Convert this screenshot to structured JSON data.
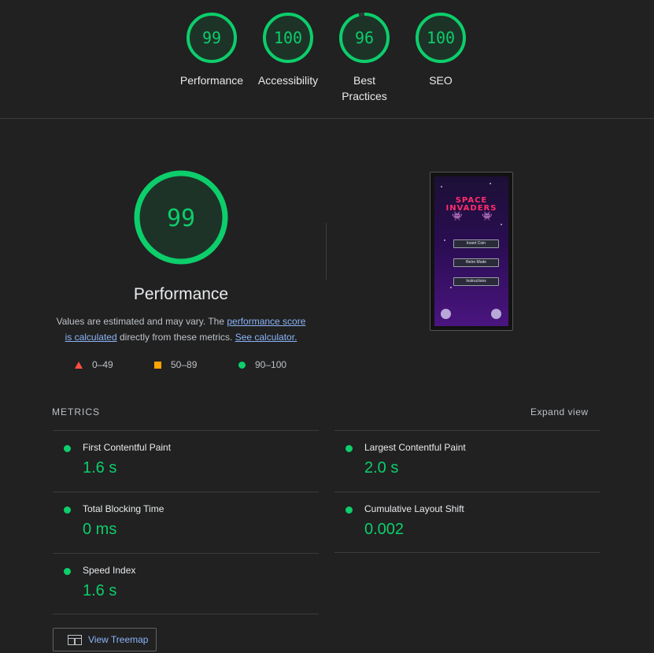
{
  "scores": [
    {
      "value": "99",
      "label": "Performance"
    },
    {
      "value": "100",
      "label": "Accessibility"
    },
    {
      "value": "96",
      "label": "Best Practices"
    },
    {
      "value": "100",
      "label": "SEO"
    }
  ],
  "performance": {
    "score": "99",
    "title": "Performance",
    "desc_prefix": "Values are estimated and may vary. The ",
    "link1": "performance score is calculated",
    "desc_middle": " directly from these metrics. ",
    "link2": "See calculator."
  },
  "legend": {
    "fail": "0–49",
    "average": "50–89",
    "pass": "90–100"
  },
  "screenshot": {
    "game_title_line1": "SPACE",
    "game_title_line2": "INVADERS",
    "buttons": [
      "Insert Coin",
      "Retro Mode",
      "Instructions"
    ]
  },
  "metrics": {
    "heading": "METRICS",
    "expand": "Expand view",
    "items": [
      {
        "label": "First Contentful Paint",
        "value": "1.6 s"
      },
      {
        "label": "Largest Contentful Paint",
        "value": "2.0 s"
      },
      {
        "label": "Total Blocking Time",
        "value": "0 ms"
      },
      {
        "label": "Cumulative Layout Shift",
        "value": "0.002"
      },
      {
        "label": "Speed Index",
        "value": "1.6 s"
      }
    ]
  },
  "treemap": {
    "label": "View Treemap"
  },
  "colors": {
    "pass": "#0cce6b",
    "average": "#ffa400",
    "fail": "#ff4e42",
    "link": "#8ab4f8"
  }
}
